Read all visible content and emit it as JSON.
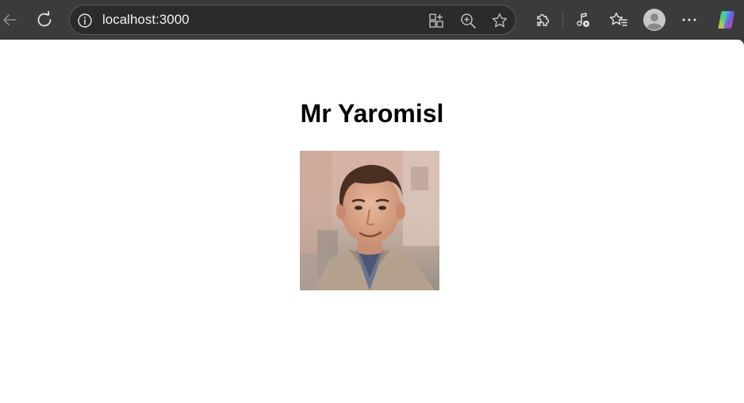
{
  "browser": {
    "address_bar": {
      "url": "localhost:3000"
    },
    "icons": [
      "back-icon",
      "refresh-icon",
      "site-info-icon",
      "split-screen-icon",
      "zoom-icon",
      "favorite-star-icon",
      "extensions-icon",
      "media-control-icon",
      "favorites-icon",
      "profile-avatar-icon",
      "more-icon",
      "copilot-icon"
    ],
    "colors": {
      "toolbar": "#3b3b3b",
      "address_bar": "#2b2b2b",
      "page_background": "#ffffff"
    }
  },
  "page": {
    "heading": "Mr Yaromisl",
    "photo": {
      "alt": "Mr Yaromisl"
    }
  }
}
